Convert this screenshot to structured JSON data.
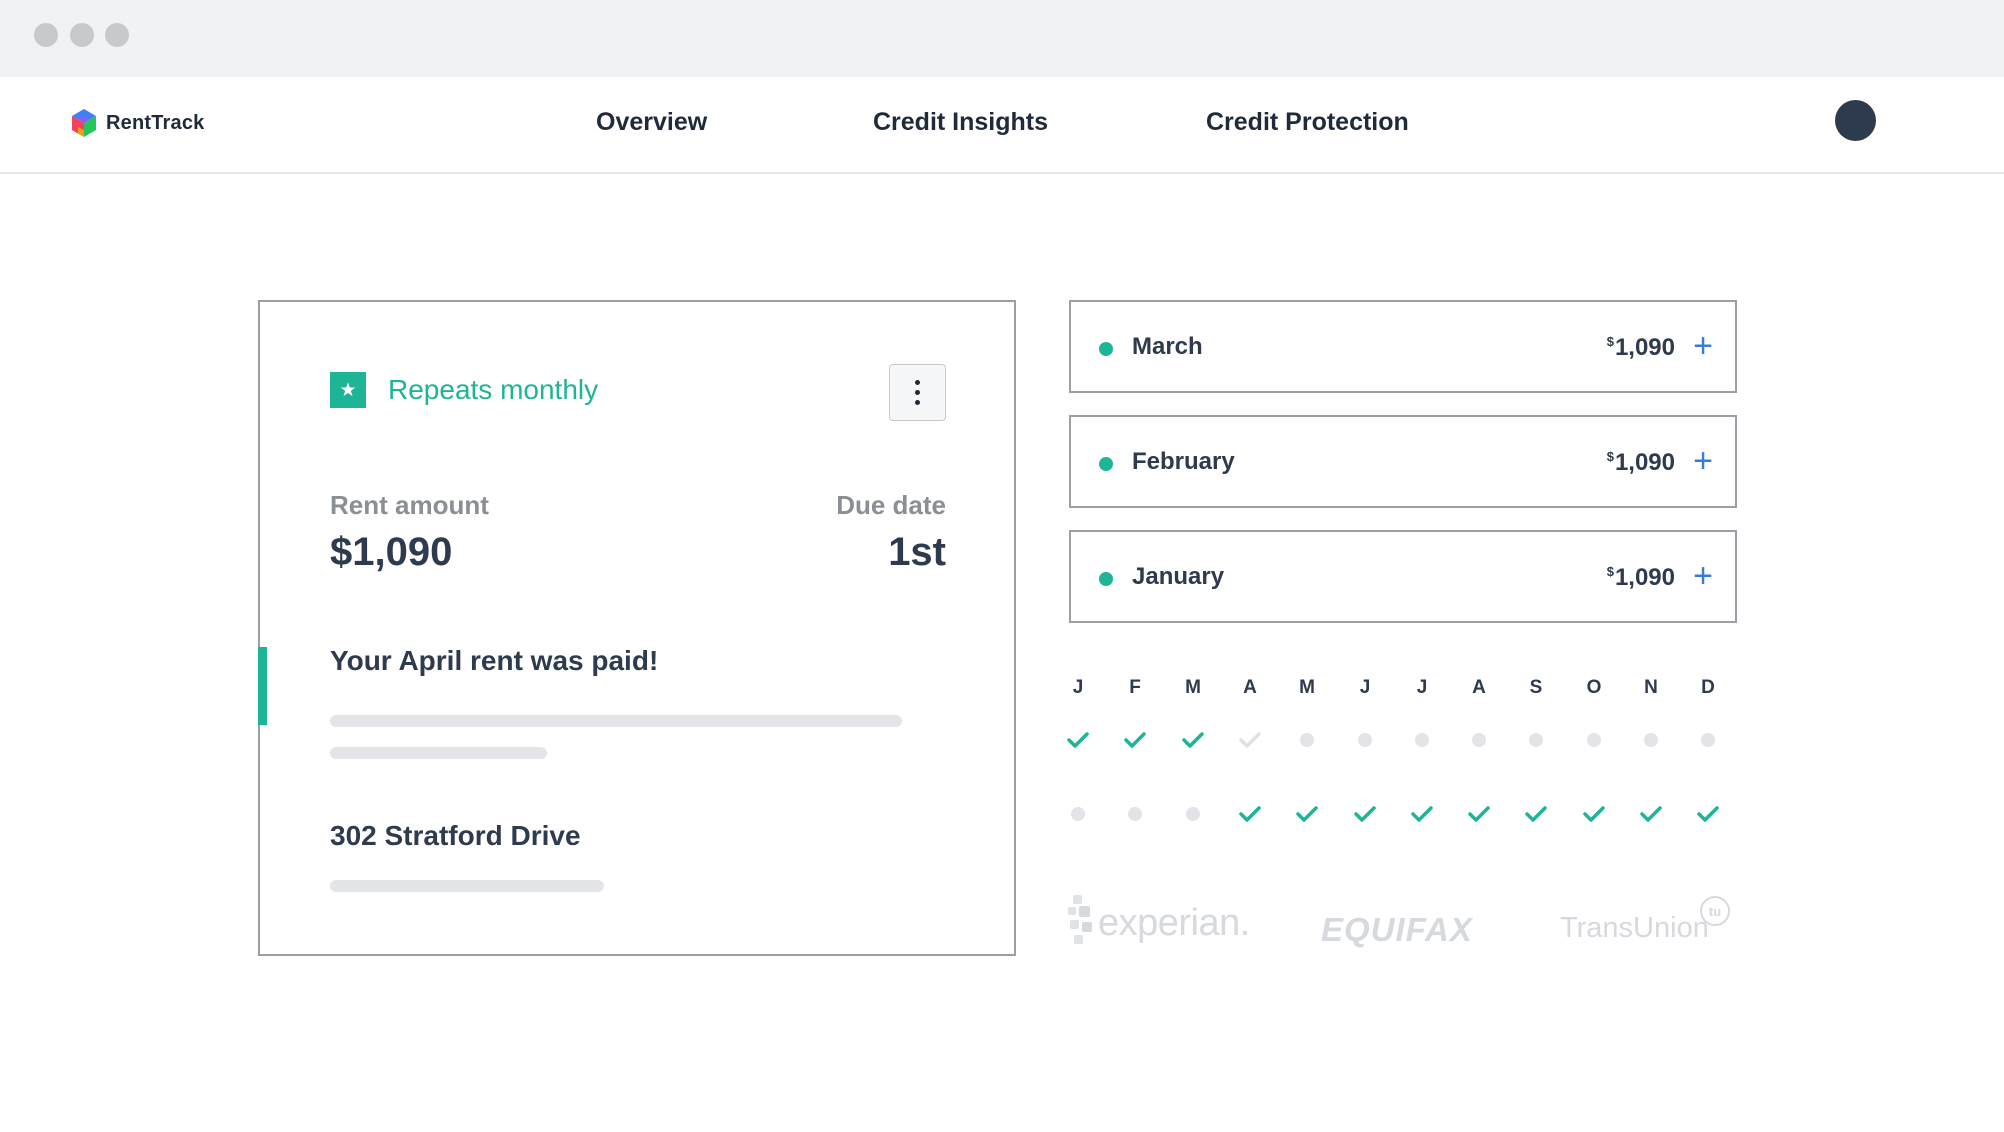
{
  "app": {
    "name": "RentTrack"
  },
  "nav": {
    "items": [
      {
        "label": "Overview"
      },
      {
        "label": "Credit Insights"
      },
      {
        "label": "Credit Protection"
      }
    ]
  },
  "rent_card": {
    "repeat_label": "Repeats monthly",
    "rent_amount_label": "Rent amount",
    "rent_amount": "$1,090",
    "due_date_label": "Due date",
    "due_date": "1st",
    "paid_message": "Your April rent was paid!",
    "address": "302  Stratford Drive"
  },
  "payments": [
    {
      "month": "March",
      "currency": "$",
      "amount": "1,090"
    },
    {
      "month": "February",
      "currency": "$",
      "amount": "1,090"
    },
    {
      "month": "January",
      "currency": "$",
      "amount": "1,090"
    }
  ],
  "calendar": {
    "months": [
      "J",
      "F",
      "M",
      "A",
      "M",
      "J",
      "J",
      "A",
      "S",
      "O",
      "N",
      "D"
    ],
    "row1": [
      "check",
      "check",
      "check",
      "check-faded",
      "dot",
      "dot",
      "dot",
      "dot",
      "dot",
      "dot",
      "dot",
      "dot"
    ],
    "row2": [
      "dot",
      "dot",
      "dot",
      "check",
      "check",
      "check",
      "check",
      "check",
      "check",
      "check",
      "check",
      "check"
    ]
  },
  "bureaus": {
    "experian": "experian.",
    "equifax": "EQUIFAX",
    "transunion": "TransUnion",
    "transunion_mark": "tu"
  },
  "colors": {
    "accent": "#1eb597",
    "text": "#2e3a4d",
    "plus": "#3a7bd5",
    "avatar": "#2e3b4e"
  },
  "icons": {
    "repeat": "star-icon",
    "menu": "more-vertical-icon",
    "add": "plus-icon",
    "paid": "check-icon"
  }
}
